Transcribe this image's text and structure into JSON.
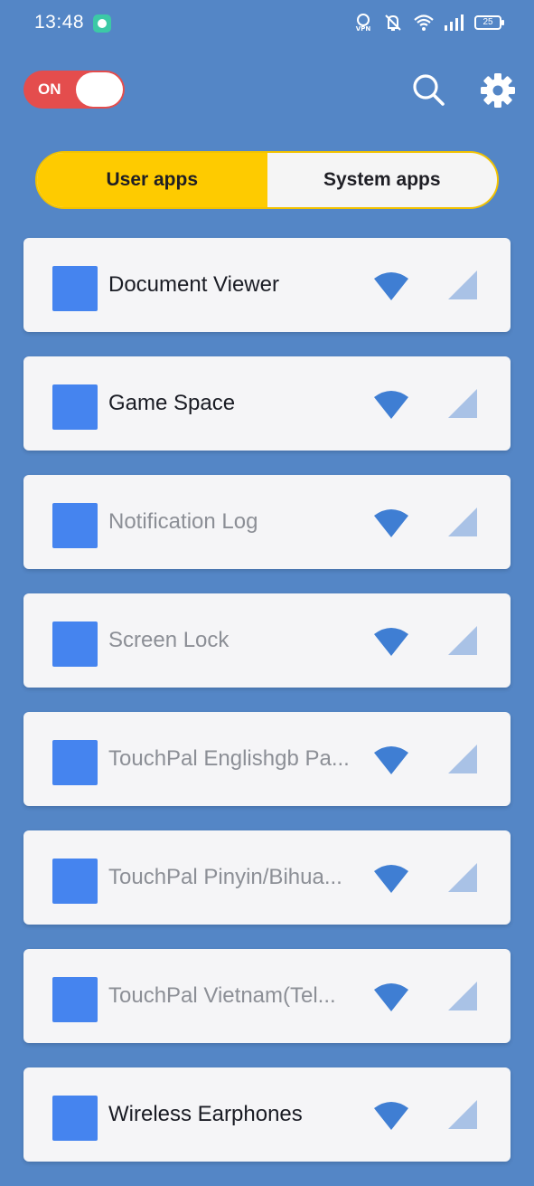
{
  "status_bar": {
    "time": "13:48",
    "battery": "25",
    "icons": [
      "chat-app-icon",
      "vpn-icon",
      "mute-icon",
      "wifi-icon",
      "signal-icon",
      "battery-icon"
    ]
  },
  "header": {
    "toggle_label": "ON",
    "toggle_on": true,
    "search_icon": "search-icon",
    "settings_icon": "gear-icon"
  },
  "tabs": [
    {
      "label": "User apps",
      "active": true
    },
    {
      "label": "System apps",
      "active": false
    }
  ],
  "apps": [
    {
      "name": "Document Viewer",
      "enabled": true
    },
    {
      "name": "Game Space",
      "enabled": true
    },
    {
      "name": "Notification Log",
      "enabled": false
    },
    {
      "name": "Screen Lock",
      "enabled": false
    },
    {
      "name": "TouchPal Englishgb Pa...",
      "enabled": false
    },
    {
      "name": "TouchPal Pinyin/Bihua...",
      "enabled": false
    },
    {
      "name": "TouchPal Vietnam(Tel...",
      "enabled": false
    },
    {
      "name": "Wireless Earphones",
      "enabled": true
    }
  ],
  "colors": {
    "background": "#5486c6",
    "toggle_on": "#e44d4d",
    "tab_active": "#fecb00",
    "app_icon": "#4584ef",
    "wifi_icon": "#3f7ed3",
    "data_icon": "#a9c2e6"
  }
}
